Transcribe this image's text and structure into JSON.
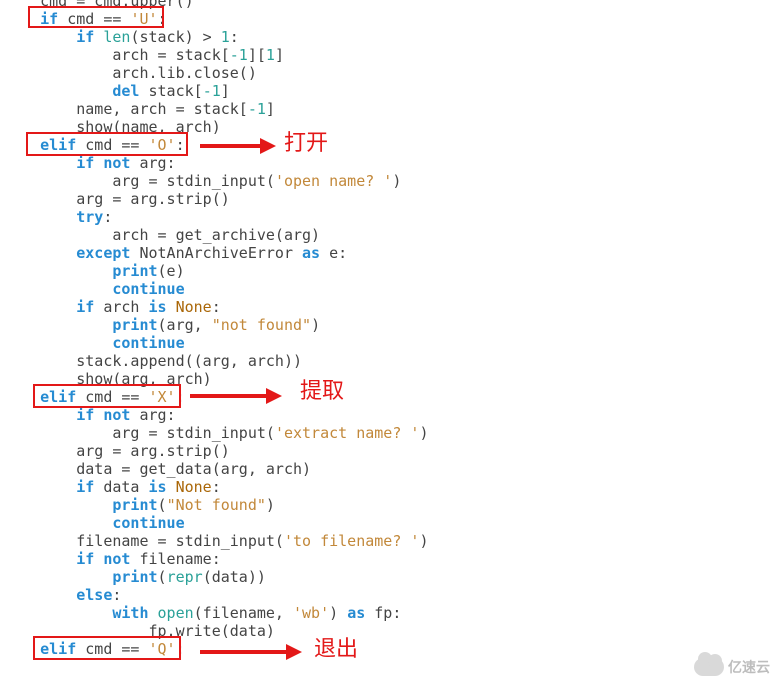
{
  "code": {
    "l00": "    cmd = cmd.upper()",
    "l01_kw": "if",
    "l01_rest": " cmd == ",
    "l01_str": "'U'",
    "l01_colon": ":",
    "l02_kw": "if",
    "l02_a": " ",
    "l02_fn": "len",
    "l02_b": "(stack) > ",
    "l02_num": "1",
    "l02_c": ":",
    "l03_a": "            arch = stack[",
    "l03_n1": "-1",
    "l03_b": "][",
    "l03_n2": "1",
    "l03_c": "]",
    "l04": "            arch.lib.close()",
    "l05_kw": "del",
    "l05_a": " stack[",
    "l05_n": "-1",
    "l05_b": "]",
    "l06_a": "        name, arch = stack[",
    "l06_n": "-1",
    "l06_b": "]",
    "l07": "        show(name, arch)",
    "l08_kw": "elif",
    "l08_a": " cmd == ",
    "l08_str": "'O'",
    "l08_colon": ":",
    "l09_kw": "if",
    "l09_sp": " ",
    "l09_not": "not",
    "l09_b": " arg:",
    "l10_a": "            arg = stdin_input(",
    "l10_str": "'open name? '",
    "l10_b": ")",
    "l11": "        arg = arg.strip()",
    "l12_kw": "try",
    "l12_colon": ":",
    "l13": "            arch = get_archive(arg)",
    "l14_kw": "except",
    "l14_cls": " NotAnArchiveError ",
    "l14_as": "as",
    "l14_e": " e:",
    "l15_kw": "print",
    "l15_a": "(e)",
    "l16_kw": "continue",
    "l17_kw": "if",
    "l17_a": " arch ",
    "l17_is": "is",
    "l17_sp": " ",
    "l17_none": "None",
    "l17_b": ":",
    "l18_kw": "print",
    "l18_a": "(arg, ",
    "l18_str": "\"not found\"",
    "l18_b": ")",
    "l19_kw": "continue",
    "l20": "        stack.append((arg, arch))",
    "l21": "        show(arg, arch)",
    "l22_kw": "elif",
    "l22_a": " cmd == ",
    "l22_str": "'X'",
    "l22_colon": ":",
    "l23_kw": "if",
    "l23_sp": " ",
    "l23_not": "not",
    "l23_b": " arg:",
    "l24_a": "            arg = stdin_input(",
    "l24_str": "'extract name? '",
    "l24_b": ")",
    "l25": "        arg = arg.strip()",
    "l26": "        data = get_data(arg, arch)",
    "l27_kw": "if",
    "l27_a": " data ",
    "l27_is": "is",
    "l27_sp": " ",
    "l27_none": "None",
    "l27_b": ":",
    "l28_kw": "print",
    "l28_a": "(",
    "l28_str": "\"Not found\"",
    "l28_b": ")",
    "l29_kw": "continue",
    "l30_a": "        filename = stdin_input(",
    "l30_str": "'to filename? '",
    "l30_b": ")",
    "l31_kw": "if",
    "l31_sp": " ",
    "l31_not": "not",
    "l31_b": " filename:",
    "l32_kw": "print",
    "l32_a": "(",
    "l32_repr": "repr",
    "l32_b": "(data))",
    "l33_kw": "else",
    "l33_colon": ":",
    "l34_kw": "with",
    "l34_sp1": " ",
    "l34_open": "open",
    "l34_a": "(filename, ",
    "l34_str": "'wb'",
    "l34_b": ") ",
    "l34_as": "as",
    "l34_c": " fp:",
    "l35": "                fp.write(data)",
    "l36_kw": "elif",
    "l36_a": " cmd == ",
    "l36_str": "'Q'",
    "l36_colon": ":"
  },
  "annotations": {
    "open": "打开",
    "extract": "提取",
    "quit": "退出"
  },
  "watermark": "亿速云"
}
